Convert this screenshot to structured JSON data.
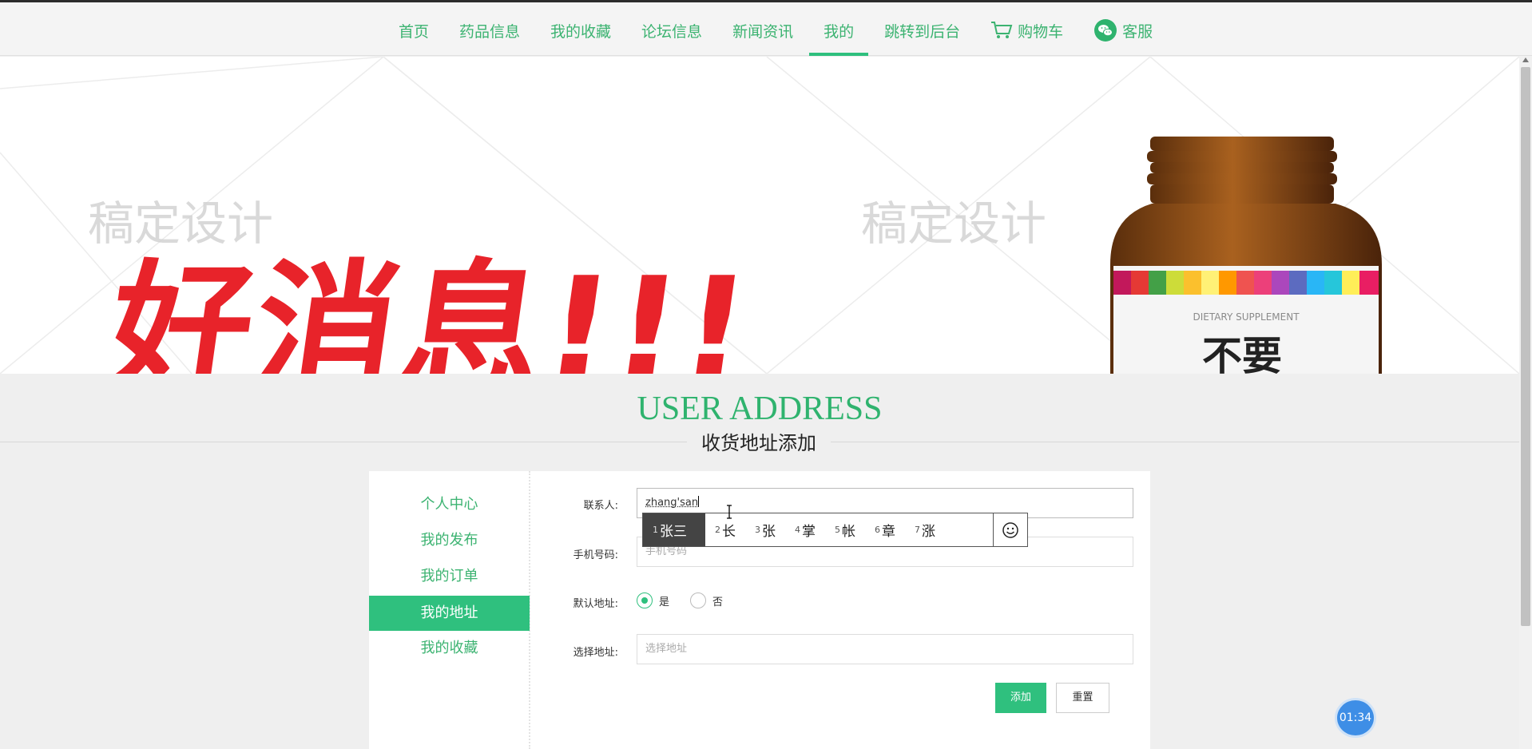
{
  "nav": {
    "items": [
      {
        "label": "首页"
      },
      {
        "label": "药品信息"
      },
      {
        "label": "我的收藏"
      },
      {
        "label": "论坛信息"
      },
      {
        "label": "新闻资讯"
      },
      {
        "label": "我的"
      },
      {
        "label": "跳转到后台"
      },
      {
        "label": "购物车",
        "icon": "cart-icon"
      },
      {
        "label": "客服",
        "icon": "wechat-icon"
      }
    ],
    "active": "我的"
  },
  "banner": {
    "headline": "好消息!!!",
    "watermark": "稿定设计",
    "bottle_label_small": "DIETARY SUPPLEMENT",
    "bottle_label_big": "不要"
  },
  "section": {
    "title": "USER ADDRESS",
    "subtitle": "收货地址添加"
  },
  "sidemenu": {
    "items": [
      {
        "label": "个人中心"
      },
      {
        "label": "我的发布"
      },
      {
        "label": "我的订单"
      },
      {
        "label": "我的地址"
      },
      {
        "label": "我的收藏"
      }
    ],
    "active": "我的地址"
  },
  "form": {
    "contact_label": "联系人:",
    "contact_value": "zhang'san",
    "phone_label": "手机号码:",
    "phone_placeholder": "手机号码",
    "default_label": "默认地址:",
    "default_yes": "是",
    "default_no": "否",
    "default_selected": "是",
    "address_label": "选择地址:",
    "address_placeholder": "选择地址",
    "add_button": "添加",
    "reset_button": "重置"
  },
  "ime": {
    "candidates": [
      {
        "num": "1",
        "text": "张三"
      },
      {
        "num": "2",
        "text": "长"
      },
      {
        "num": "3",
        "text": "张"
      },
      {
        "num": "4",
        "text": "掌"
      },
      {
        "num": "5",
        "text": "帐"
      },
      {
        "num": "6",
        "text": "章"
      },
      {
        "num": "7",
        "text": "涨"
      }
    ],
    "emoji_icon": "smiley-icon"
  },
  "timer": "01:34",
  "colors": {
    "accent": "#2fc07e",
    "link": "#3cb371",
    "banner_red": "#e8232a"
  }
}
